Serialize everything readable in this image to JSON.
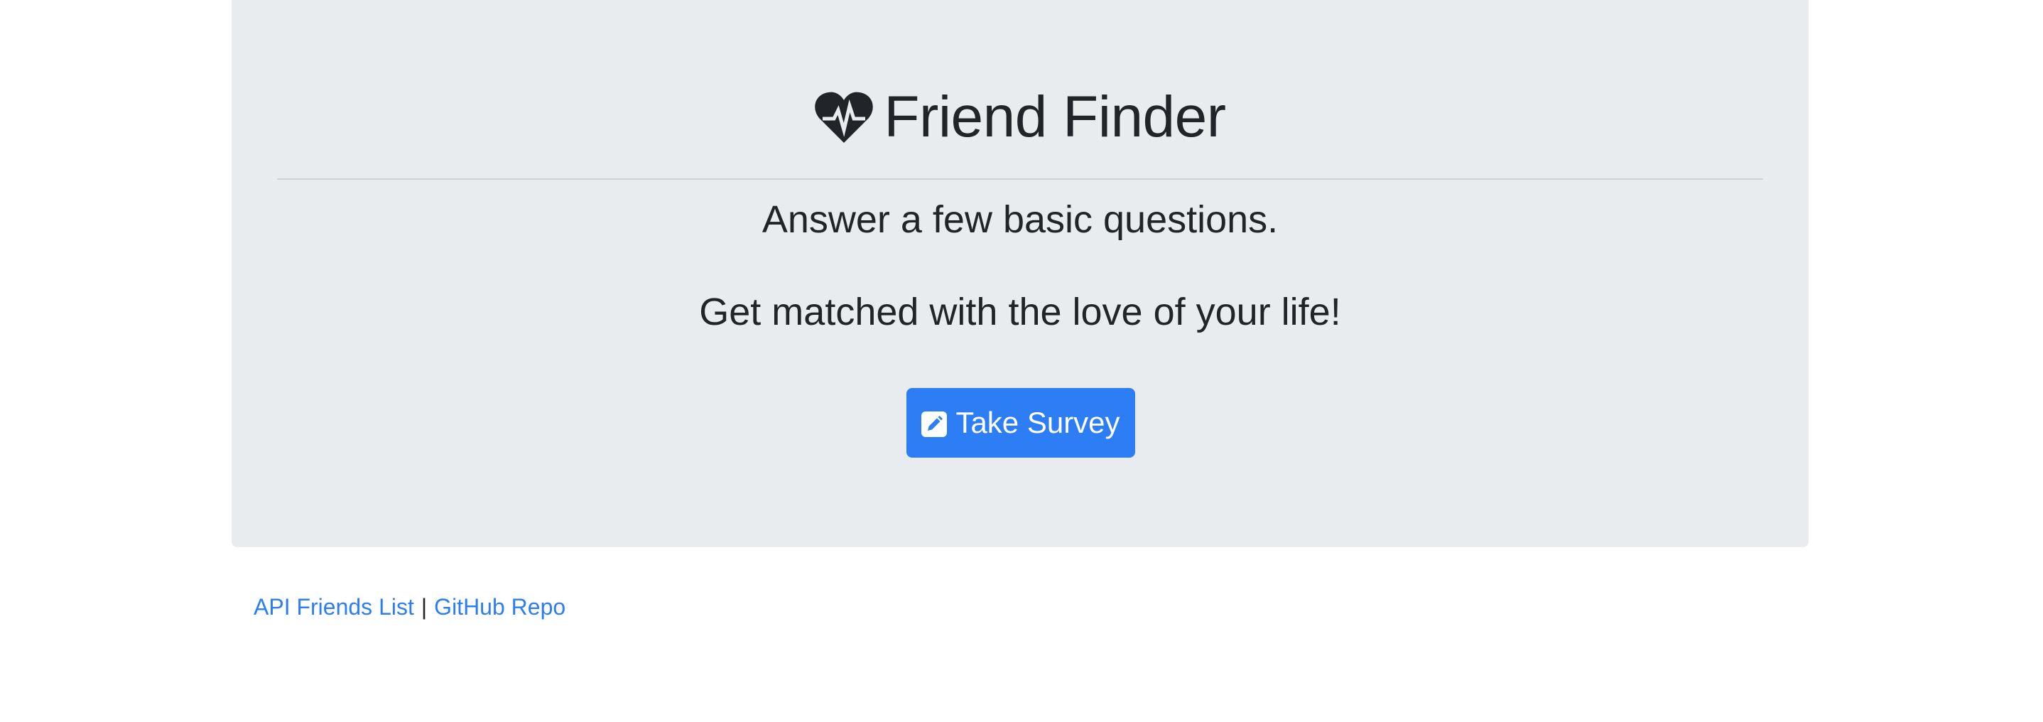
{
  "header": {
    "title": "Friend Finder",
    "icon": "heartbeat-icon"
  },
  "main": {
    "lead_1": "Answer a few basic questions.",
    "lead_2": "Get matched with the love of your life!",
    "survey_button": {
      "label": "Take Survey",
      "icon": "edit-icon"
    }
  },
  "footer": {
    "api_link": "API Friends List",
    "separator": "|",
    "github_link": "GitHub Repo"
  },
  "colors": {
    "jumbotron_bg": "#e9ecef",
    "primary": "#2d7ef5",
    "text": "#212529"
  }
}
